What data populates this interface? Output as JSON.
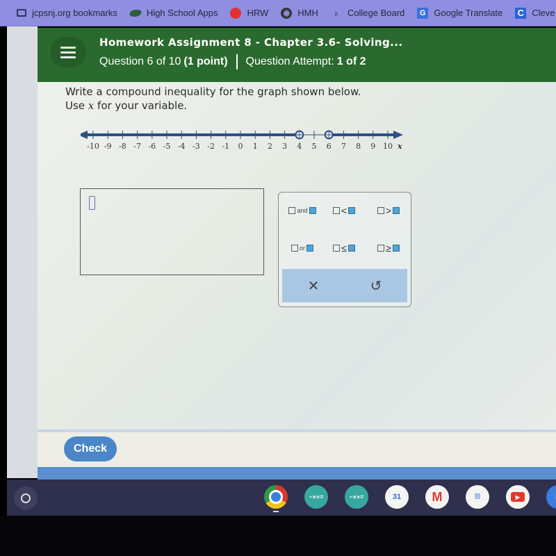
{
  "bookmarks": [
    {
      "label": "jcpsnj.org bookmarks",
      "icon": "folder-icon",
      "glyph": ""
    },
    {
      "label": "High School Apps",
      "icon": "apps-leaf-icon",
      "glyph": ""
    },
    {
      "label": "HRW",
      "icon": "red-dot-icon",
      "glyph": ""
    },
    {
      "label": "HMH",
      "icon": "globe-icon",
      "glyph": "◉"
    },
    {
      "label": "College Board",
      "icon": "acorn-icon",
      "glyph": "♁"
    },
    {
      "label": "Google Translate",
      "icon": "translate-icon",
      "glyph": "G"
    },
    {
      "label": "Cleve",
      "icon": "c-logo-icon",
      "glyph": "C"
    }
  ],
  "header": {
    "menu_icon": "hamburger-menu-icon",
    "title": "Homework Assignment 8 - Chapter 3.6- Solving...",
    "question_label": "Question 6 of 10",
    "points": "(1 point)",
    "attempt_label": "Question Attempt:",
    "attempt_value": "1 of 2"
  },
  "question": {
    "line1": "Write a compound inequality for the graph shown below.",
    "line2_pre": "Use ",
    "variable": "x",
    "line2_post": " for your variable."
  },
  "number_line": {
    "min": -10,
    "max": 10,
    "ticks": [
      -10,
      -9,
      -8,
      -7,
      -6,
      -5,
      -4,
      -3,
      -2,
      -1,
      0,
      1,
      2,
      3,
      4,
      5,
      6,
      7,
      8,
      9,
      10
    ],
    "axis_label": "x",
    "open_points": [
      4,
      6
    ],
    "shaded_segments": [
      {
        "from": "-inf",
        "to": 4
      },
      {
        "from": 6,
        "to": "inf"
      }
    ],
    "line_color": "#2d4f86"
  },
  "answer_input": {
    "value": ""
  },
  "keypad": {
    "keys": [
      {
        "name": "and-key",
        "left": "□",
        "op": "and",
        "right": "□",
        "type": "word"
      },
      {
        "name": "less-than-key",
        "left": "□",
        "op": "<",
        "right": "□",
        "type": "symbol"
      },
      {
        "name": "greater-than-key",
        "left": "□",
        "op": ">",
        "right": "□",
        "type": "symbol"
      },
      {
        "name": "or-key",
        "left": "□",
        "op": "or",
        "right": "□",
        "type": "word"
      },
      {
        "name": "less-equal-key",
        "left": "□",
        "op": "≤",
        "right": "□",
        "type": "symbol"
      },
      {
        "name": "greater-equal-key",
        "left": "□",
        "op": "≥",
        "right": "□",
        "type": "symbol"
      }
    ],
    "clear_glyph": "✕",
    "undo_glyph": "↺"
  },
  "footer": {
    "check_label": "Check"
  },
  "shelf": {
    "apps": [
      {
        "name": "chrome-app-icon",
        "glyph": ""
      },
      {
        "name": "calculator-app-icon",
        "glyph": "−×+="
      },
      {
        "name": "calculator-app-icon-2",
        "glyph": "−×+="
      },
      {
        "name": "calendar-app-icon",
        "glyph": "31"
      },
      {
        "name": "gmail-app-icon",
        "glyph": "M"
      },
      {
        "name": "docs-app-icon",
        "glyph": "≡"
      },
      {
        "name": "youtube-app-icon",
        "glyph": "▶"
      },
      {
        "name": "camera-app-icon",
        "glyph": "◘"
      }
    ]
  }
}
